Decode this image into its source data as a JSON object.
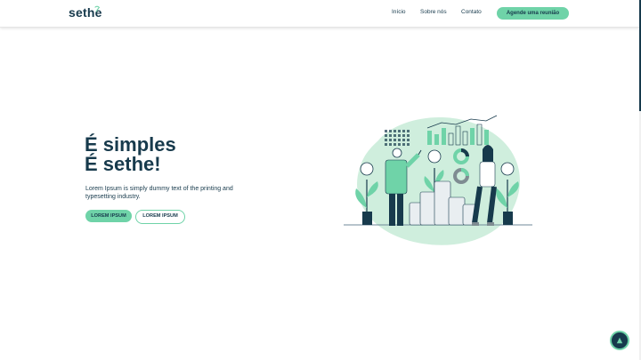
{
  "header": {
    "logo": "sethe",
    "nav": [
      {
        "label": "Início"
      },
      {
        "label": "Sobre nós"
      },
      {
        "label": "Contato"
      }
    ],
    "cta_label": "Agende uma reunião"
  },
  "hero": {
    "title_line1": "É simples",
    "title_line2": "É sethe!",
    "description": "Lorem Ipsum is simply dummy text of the printing and typesetting industry.",
    "primary_button": "LOREM IPSUM",
    "secondary_button": "LOREM IPSUM"
  },
  "colors": {
    "brand_dark": "#173a4c",
    "accent_green": "#6fd3a8",
    "illustration_bg": "#cfeedd"
  },
  "icons": {
    "scroll_top": "triangle-up-icon"
  }
}
